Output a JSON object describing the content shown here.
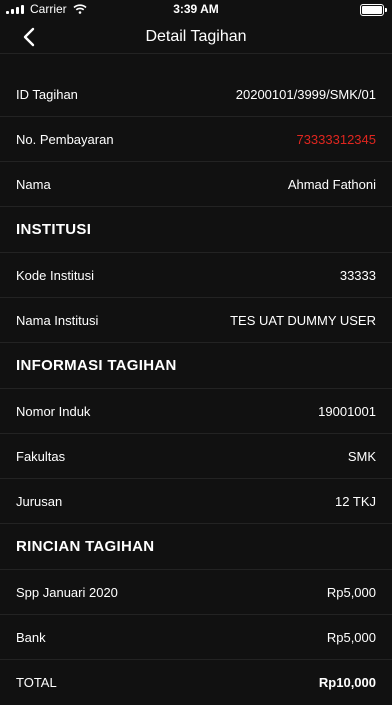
{
  "status_bar": {
    "carrier": "Carrier",
    "time": "3:39 AM"
  },
  "nav": {
    "title": "Detail Tagihan"
  },
  "rows_top": [
    {
      "label": "ID Tagihan",
      "value": "20200101/3999/SMK/01"
    },
    {
      "label": "No. Pembayaran",
      "value": "73333312345",
      "value_color": "#e0261f"
    },
    {
      "label": "Nama",
      "value": "Ahmad Fathoni"
    }
  ],
  "institusi": {
    "header": "INSTITUSI",
    "rows": [
      {
        "label": "Kode Institusi",
        "value": "33333"
      },
      {
        "label": "Nama Institusi",
        "value": "TES UAT DUMMY USER"
      }
    ]
  },
  "informasi": {
    "header": "INFORMASI TAGIHAN",
    "rows": [
      {
        "label": "Nomor Induk",
        "value": "19001001"
      },
      {
        "label": "Fakultas",
        "value": "SMK"
      },
      {
        "label": "Jurusan",
        "value": "12 TKJ"
      }
    ]
  },
  "rincian": {
    "header": "RINCIAN TAGIHAN",
    "rows": [
      {
        "label": "Spp Januari 2020",
        "value": "Rp5,000"
      },
      {
        "label": "Bank",
        "value": "Rp5,000"
      }
    ],
    "total": {
      "label": "TOTAL",
      "value": "Rp10,000"
    }
  },
  "icons": {
    "back": "chevron-left-icon",
    "wifi": "wifi-icon",
    "signal": "signal-icon",
    "battery": "battery-icon"
  },
  "colors": {
    "background": "#111111",
    "divider": "#232323",
    "text": "#ffffff",
    "accent_red": "#e0261f"
  }
}
